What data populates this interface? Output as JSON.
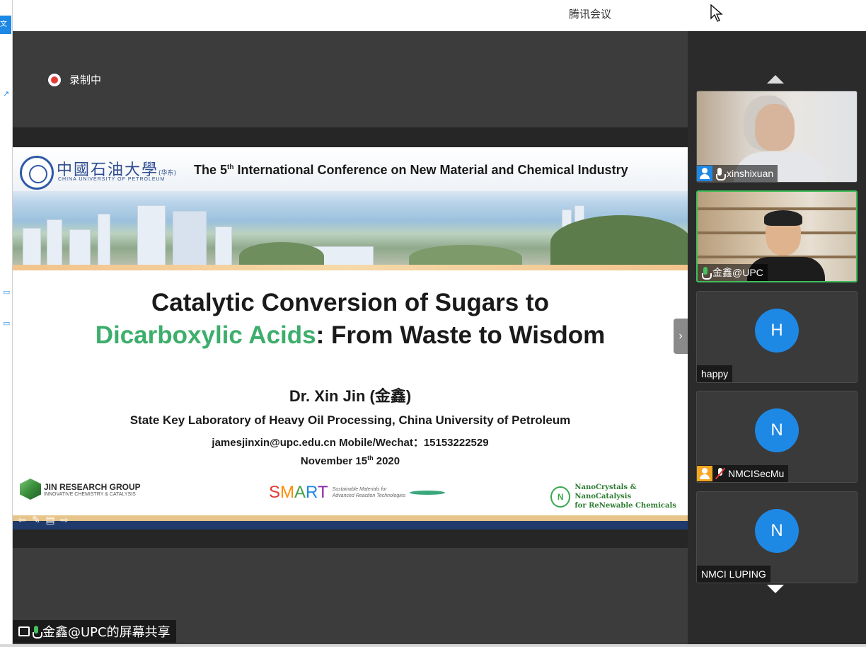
{
  "window": {
    "title": "腾讯会议",
    "left_tag": "文件"
  },
  "recording": {
    "label": "录制中",
    "dot_color": "#e53935"
  },
  "slide": {
    "university_cn": "中國石油大學",
    "university_cn_suffix": "(华东)",
    "university_en": "CHINA UNIVERSITY OF PETROLEUM",
    "conference_prefix": "The 5",
    "conference_sup": "th",
    "conference_rest": " International Conference on New Material and Chemical Industry",
    "title_line1": "Catalytic Conversion of Sugars to",
    "title_line2_highlight": "Dicarboxylic Acids",
    "title_line2_rest": ": From Waste to Wisdom",
    "highlight_color": "#3dae6b",
    "author": "Dr. Xin Jin (金鑫)",
    "lab": "State Key Laboratory of Heavy Oil Processing, China University of Petroleum",
    "contact": "jamesjinxin@upc.edu.cn   Mobile/Wechat：15153222529",
    "date_prefix": "November 15",
    "date_sup": "th",
    "date_rest": " 2020",
    "logos": {
      "jin_name": "JIN RESEARCH GROUP",
      "jin_sub": "INNOVATIVE CHEMISTRY & CATALYSIS",
      "smart_letters": [
        "S",
        "M",
        "A",
        "R",
        "T"
      ],
      "smart_sub1": "Sustainable Materials for",
      "smart_sub2": "Advanced Reaction Technologies",
      "nano_line1": "NanoCrystals & NanoCatalysis",
      "nano_line2": "for ReNewable Chemicals",
      "nano_icon": "N"
    }
  },
  "share_label": "金鑫@UPC的屏幕共享",
  "participants": [
    {
      "name": "xinshixuan",
      "type": "video",
      "icon": "person-icon",
      "mic": "on"
    },
    {
      "name": "金鑫@UPC",
      "type": "video",
      "active": true,
      "mic": "speaking"
    },
    {
      "name": "happy",
      "type": "avatar",
      "initial": "H"
    },
    {
      "name": "NMCISecMu",
      "type": "avatar",
      "initial": "N",
      "icon": "person-icon-orange",
      "mic": "muted"
    },
    {
      "name": "NMCI LUPING",
      "type": "avatar",
      "initial": "N"
    }
  ],
  "colors": {
    "panel_bg": "#2b2b2b",
    "avatar_blue": "#1e88e5",
    "speaking_green": "#3fbf5a"
  }
}
